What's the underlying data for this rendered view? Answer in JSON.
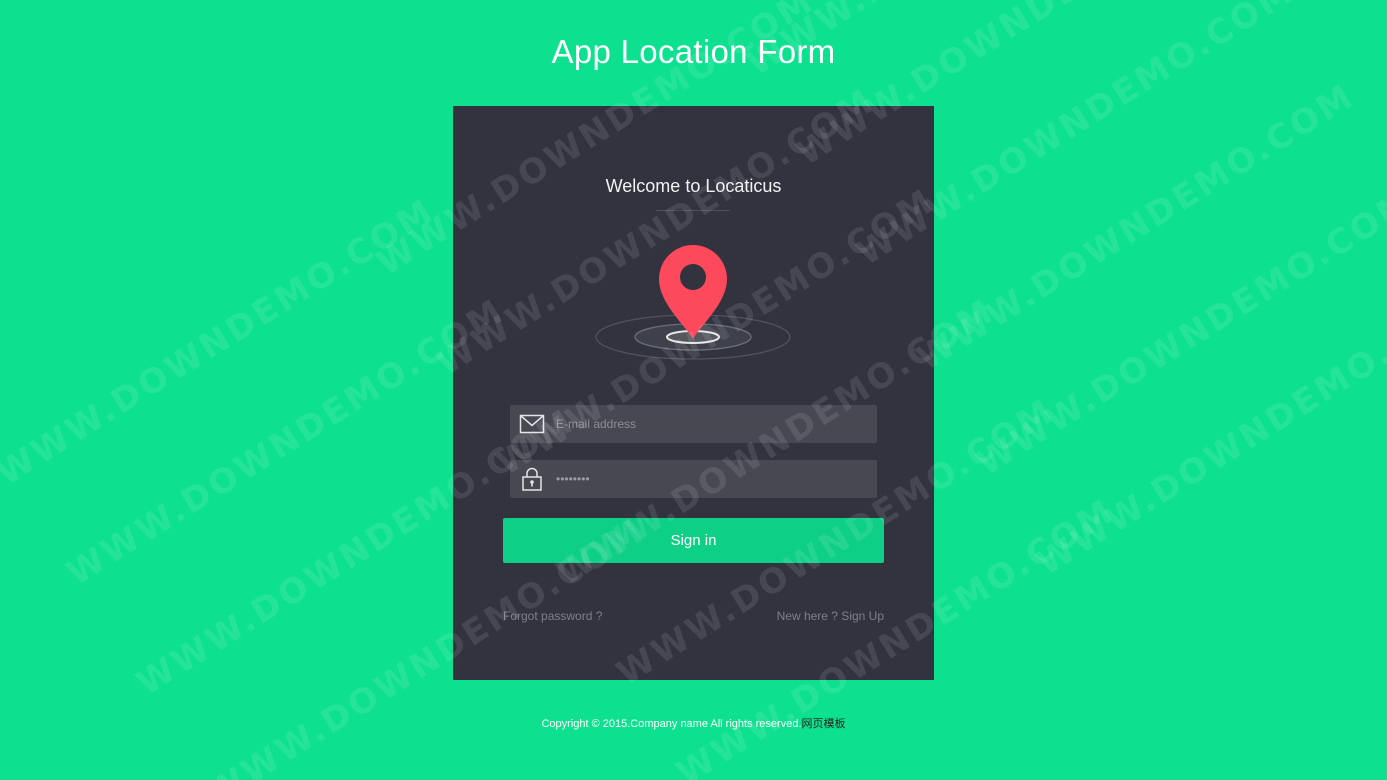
{
  "header": {
    "title": "App Location Form"
  },
  "card": {
    "welcome": "Welcome to Locaticus",
    "email": {
      "placeholder": "E-mail address",
      "icon": "envelope-icon"
    },
    "password": {
      "value": "••••••••",
      "icon": "lock-icon"
    },
    "signin_label": "Sign in",
    "forgot_label": "Forgot password ?",
    "signup_label": "New here ? Sign Up"
  },
  "footer": {
    "text": "Copyright © 2015.Company name All rights reserved.",
    "link": "网页模板"
  },
  "watermark": "WWW.DOWNDEMO.COM",
  "colors": {
    "background": "#0de18f",
    "card": "#32333f",
    "field": "#474852",
    "button": "#0dcf86",
    "pin": "#fc4a5c"
  }
}
